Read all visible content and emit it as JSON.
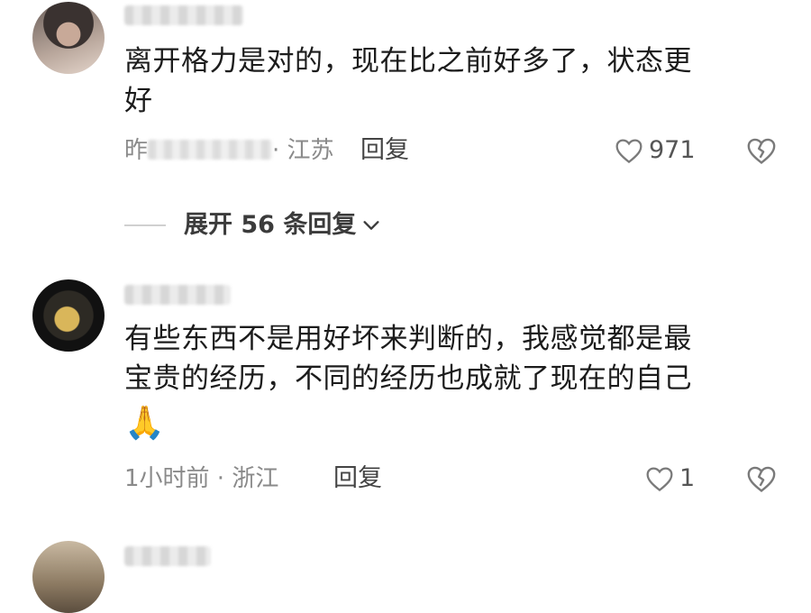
{
  "comments": [
    {
      "text_lines": [
        "离开格力是对的，现在比之前好多了，状态更",
        "好"
      ],
      "meta_location": "· 江苏",
      "meta_time_prefix": "昨",
      "reply_label": "回复",
      "like_count": "971",
      "expand_label": "展开 56 条回复"
    },
    {
      "text_lines": [
        "有些东西不是用好坏来判断的，我感觉都是最",
        "宝贵的经历，不同的经历也成就了现在的自己"
      ],
      "emoji": "🙏",
      "meta_text": "1小时前 · 浙江",
      "reply_label": "回复",
      "like_count": "1"
    }
  ],
  "icons": {
    "like": "heart-outline-icon",
    "dislike": "broken-heart-icon",
    "expand": "chevron-down-icon"
  }
}
